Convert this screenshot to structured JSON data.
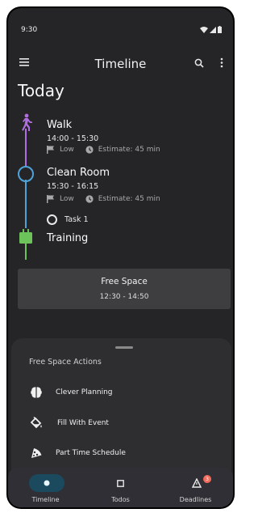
{
  "status_bar": {
    "time": "9:30"
  },
  "app_bar": {
    "title": "Timeline"
  },
  "section_title": "Today",
  "events": [
    {
      "title": "Walk",
      "time": "14:00 - 15:30",
      "priority": "Low",
      "estimate": "Estimate: 45 min",
      "color": "#b06ee0"
    },
    {
      "title": "Clean Room",
      "time": "15:30 - 16:15",
      "priority": "Low",
      "estimate": "Estimate: 45 min",
      "color": "#4fa3d9"
    },
    {
      "title": "Training",
      "color": "#6cc35a"
    }
  ],
  "task": {
    "label": "Task 1"
  },
  "free_space": {
    "title": "Free Space",
    "time": "12:30 - 14:50"
  },
  "sheet": {
    "heading": "Free Space Actions",
    "actions": [
      {
        "label": "Clever Planning",
        "icon": "brain-icon"
      },
      {
        "label": "Fill With Event",
        "icon": "fill-bucket-icon"
      },
      {
        "label": "Part Time Schedule",
        "icon": "pizza-slice-icon"
      }
    ]
  },
  "bottom_nav": {
    "items": [
      {
        "label": "Timeline",
        "active": true
      },
      {
        "label": "Todos",
        "active": false
      },
      {
        "label": "Deadlines",
        "active": false,
        "badge": "3"
      }
    ]
  },
  "colors": {
    "accent_active": "#1b4a5e",
    "badge": "#f26b5b"
  }
}
